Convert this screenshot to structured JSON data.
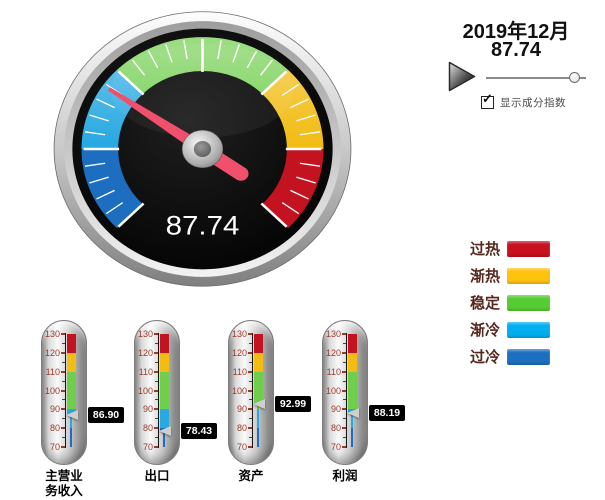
{
  "controls": {
    "period_label": "2019年12月",
    "value_display": "87.74",
    "play_icon": "play-triangle-icon",
    "slider_pos": 0.93,
    "checkbox_checked": true,
    "check_glyph": "✓",
    "checkbox_label": "显示成分指数"
  },
  "gauge": {
    "value": 87.74,
    "display_value": "87.74",
    "min": 70,
    "max": 130,
    "start_angle": -135,
    "end_angle": 135,
    "major_step": 10,
    "minor_step": 2,
    "needle_color": "#f0506b",
    "zones": [
      {
        "label": "过冷",
        "from": 70,
        "to": 80,
        "color": "#1d6ec0"
      },
      {
        "label": "渐冷",
        "from": 80,
        "to": 90,
        "color": "#29a9e1"
      },
      {
        "label": "稳定",
        "from": 90,
        "to": 110,
        "color": "#6fce4b"
      },
      {
        "label": "渐热",
        "from": 110,
        "to": 120,
        "color": "#f2bc14"
      },
      {
        "label": "过热",
        "from": 120,
        "to": 130,
        "color": "#c41320"
      }
    ]
  },
  "legend": {
    "items": [
      {
        "label": "过热",
        "color": "#c8101e"
      },
      {
        "label": "渐热",
        "color": "#ffc20e"
      },
      {
        "label": "稳定",
        "color": "#55cc33"
      },
      {
        "label": "渐冷",
        "color": "#00aeef"
      },
      {
        "label": "过冷",
        "color": "#1b6fc0"
      }
    ]
  },
  "thermometers": {
    "min": 70,
    "max": 130,
    "major_step": 10,
    "minor_step": 5,
    "items": [
      {
        "label": "主营业务收入",
        "label_lines": "主营业\n务收入",
        "value": 86.9,
        "display": "86.90"
      },
      {
        "label": "出口",
        "label_lines": "出口",
        "value": 78.43,
        "display": "78.43"
      },
      {
        "label": "资产",
        "label_lines": "资产",
        "value": 92.99,
        "display": "92.99"
      },
      {
        "label": "利润",
        "label_lines": "利润",
        "value": 88.19,
        "display": "88.19"
      }
    ]
  },
  "chart_data": [
    {
      "type": "gauge",
      "date_label": "2019年12月",
      "value": 87.74,
      "min": 70,
      "max": 130,
      "zones": [
        {
          "label": "过冷",
          "range": [
            70,
            80
          ]
        },
        {
          "label": "渐冷",
          "range": [
            80,
            90
          ]
        },
        {
          "label": "稳定",
          "range": [
            90,
            110
          ]
        },
        {
          "label": "渐热",
          "range": [
            110,
            120
          ]
        },
        {
          "label": "过热",
          "range": [
            120,
            130
          ]
        }
      ]
    },
    {
      "type": "thermometer",
      "categories": [
        "主营业务收入",
        "出口",
        "资产",
        "利润"
      ],
      "values": [
        86.9,
        78.43,
        92.99,
        88.19
      ],
      "ylim": [
        70,
        130
      ]
    }
  ]
}
